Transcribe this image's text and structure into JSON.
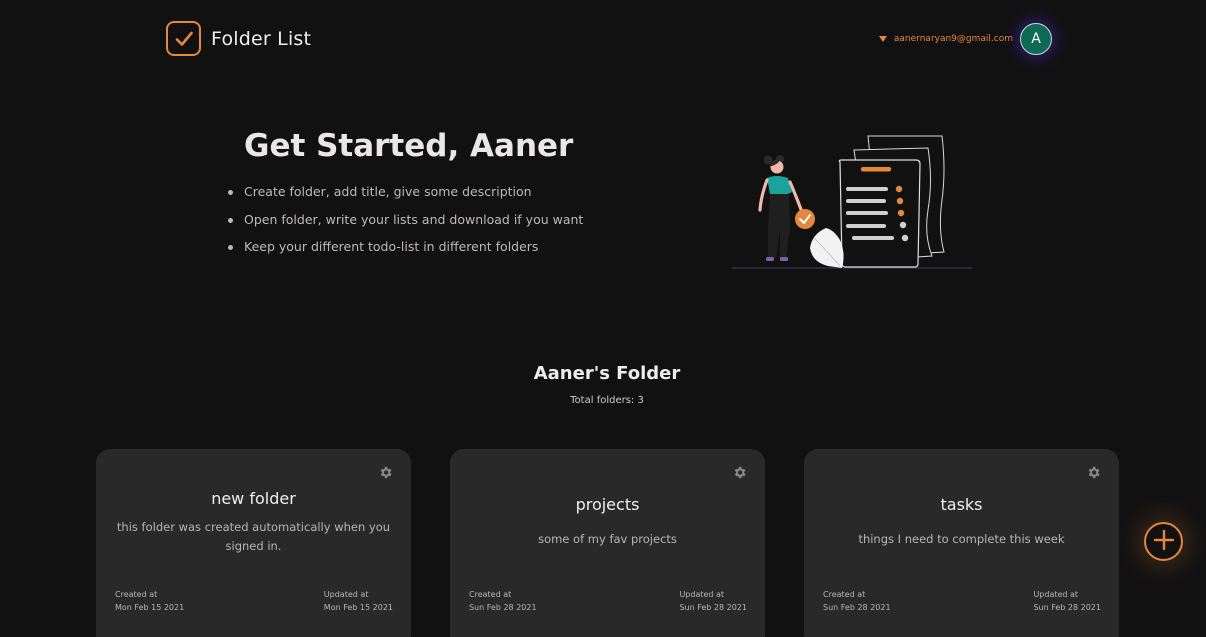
{
  "header": {
    "app_title": "Folder List",
    "email": "aanernaryan9@gmail.com",
    "avatar_letter": "A"
  },
  "hero": {
    "title": "Get Started, Aaner",
    "bullets": [
      "Create folder, add title, give some description",
      "Open folder, write your lists and download if you want",
      "Keep your different todo-list in different folders"
    ]
  },
  "section": {
    "title": "Aaner's Folder",
    "count_text": "Total folders: 3"
  },
  "folders": [
    {
      "title": "new folder",
      "description": "this folder was created automatically when you signed in.",
      "created_label": "Created at",
      "created": "Mon Feb 15 2021",
      "updated_label": "Updated at",
      "updated": "Mon Feb 15 2021"
    },
    {
      "title": "projects",
      "description": "some of my fav projects",
      "created_label": "Created at",
      "created": "Sun Feb 28 2021",
      "updated_label": "Updated at",
      "updated": "Sun Feb 28 2021"
    },
    {
      "title": "tasks",
      "description": "things I need to complete this week",
      "created_label": "Created at",
      "created": "Sun Feb 28 2021",
      "updated_label": "Updated at",
      "updated": "Sun Feb 28 2021"
    }
  ],
  "icons": {
    "logo": "checkbox-icon",
    "dropdown": "caret-down-icon",
    "card_settings": "gear-icon",
    "add": "plus-circle-icon"
  },
  "colors": {
    "accent": "#e5883a",
    "background": "#121112",
    "card": "#2a292a",
    "avatar": "#0d6b55"
  }
}
